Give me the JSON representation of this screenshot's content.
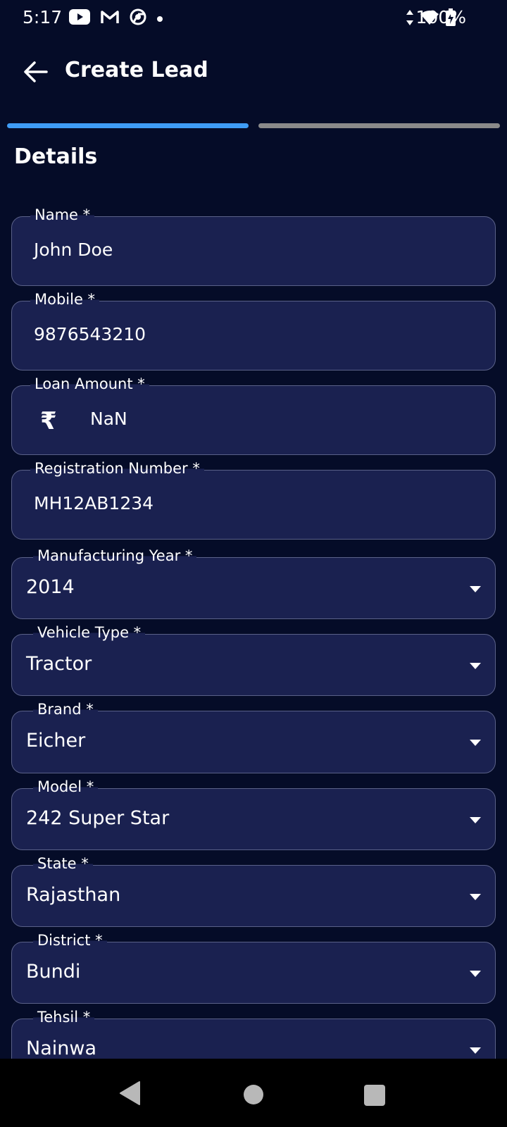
{
  "status_bar": {
    "time": "5:17",
    "battery": "100%",
    "icons_left": [
      "youtube-icon",
      "gmail-icon",
      "chrome-icon",
      "dot-icon"
    ],
    "icons_right": [
      "data-arrows-icon",
      "wifi-icon",
      "battery-charging-icon"
    ]
  },
  "header": {
    "title": "Create Lead",
    "back_icon": "arrow-left-icon"
  },
  "progress": {
    "steps": 2,
    "active_step": 1,
    "active_color": "#3f9cf5",
    "inactive_color": "#8a8a8a"
  },
  "section": {
    "title": "Details"
  },
  "fields": {
    "name": {
      "label": "Name *",
      "value": "John Doe"
    },
    "mobile": {
      "label": "Mobile *",
      "value": "9876543210"
    },
    "loan_amount": {
      "label": "Loan Amount *",
      "currency_symbol": "₹",
      "value": "NaN"
    },
    "registration": {
      "label": "Registration Number *",
      "value": "MH12AB1234"
    }
  },
  "selects": {
    "manufacturing_year": {
      "label": "Manufacturing Year *",
      "value": "2014"
    },
    "vehicle_type": {
      "label": "Vehicle Type *",
      "value": "Tractor"
    },
    "brand": {
      "label": "Brand *",
      "value": "Eicher"
    },
    "model": {
      "label": "Model *",
      "value": "242 Super Star"
    },
    "state": {
      "label": "State *",
      "value": "Rajasthan"
    },
    "district": {
      "label": "District *",
      "value": "Bundi"
    },
    "tehsil": {
      "label": "Tehsil *",
      "value": "Nainwa"
    }
  },
  "colors": {
    "background": "#050c28",
    "field_background": "#1a2150",
    "field_border": "#5a6188"
  }
}
